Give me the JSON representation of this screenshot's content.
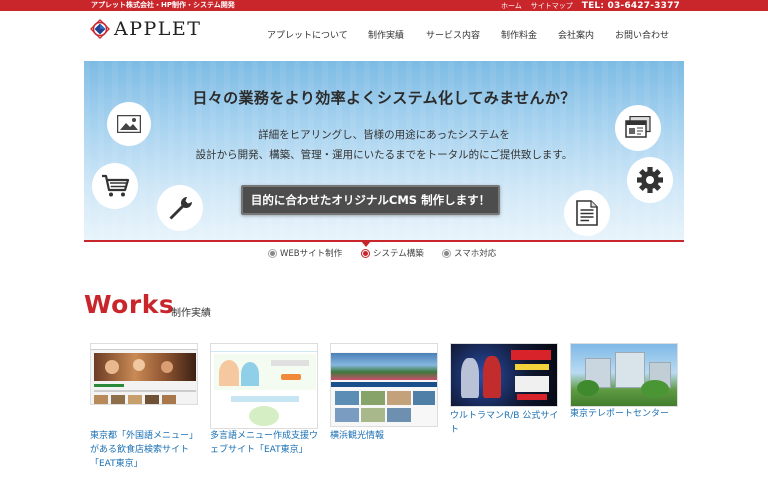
{
  "topbar": {
    "tagline": "アプレット株式会社・HP制作・システム開発",
    "links": [
      "ホーム",
      "サイトマップ"
    ],
    "tel": "TEL: 03-6427-3377"
  },
  "header": {
    "logo_text": "APPLET",
    "nav": [
      "アプレットについて",
      "制作実績",
      "サービス内容",
      "制作料金",
      "会社案内",
      "お問い合わせ"
    ]
  },
  "hero": {
    "title": "日々の業務をより効率よくシステム化してみませんか？",
    "desc_line1": "詳細をヒアリングし、皆様の用途にあったシステムを",
    "desc_line2": "設計から開発、構築、管理・運用にいたるまでをトータル的にご提供致します。",
    "cta": "目的に合わせたオリジナルCMS 制作します！",
    "icons": [
      "image-icon",
      "cart-icon",
      "wrench-icon",
      "browser-window-icon",
      "gear-icon",
      "document-icon"
    ],
    "accent_color": "#c9262b"
  },
  "tabs": [
    {
      "label": "WEBサイト制作",
      "active": false
    },
    {
      "label": "システム構築",
      "active": true
    },
    {
      "label": "スマホ対応",
      "active": false
    }
  ],
  "works": {
    "title": "Works",
    "subtitle": "制作実績",
    "items": [
      {
        "caption": "東京都「外国語メニュー」がある飲食店検索サイト「EAT東京」"
      },
      {
        "caption": "多言語メニュー作成支援ウェブサイト「EAT東京」"
      },
      {
        "caption": "横浜観光情報"
      },
      {
        "caption": "ウルトラマンR/B 公式サイト"
      },
      {
        "caption": "東京テレポートセンター"
      }
    ]
  }
}
